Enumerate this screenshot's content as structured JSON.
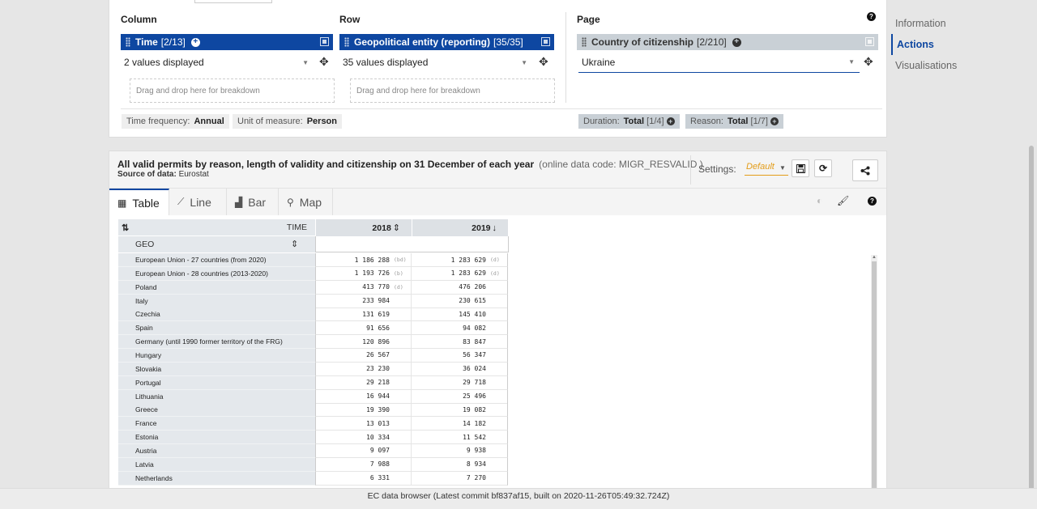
{
  "layout_panel": {
    "column": {
      "title": "Column",
      "dimension_name": "Time",
      "dimension_count": "[2/13]",
      "selection": "2 values displayed",
      "dropzone": "Drag and drop here for breakdown"
    },
    "row": {
      "title": "Row",
      "dimension_name": "Geopolitical entity (reporting)",
      "dimension_count": "[35/35]",
      "selection": "35 values displayed",
      "dropzone": "Drag and drop here for breakdown"
    },
    "page": {
      "title": "Page",
      "dimension_name": "Country of citizenship",
      "dimension_count": "[2/210]",
      "selection": "Ukraine"
    },
    "fixed_chips": [
      {
        "label": "Time frequency:",
        "value": "Annual"
      },
      {
        "label": "Unit of measure:",
        "value": "Person"
      }
    ],
    "page_chips": [
      {
        "label": "Duration:",
        "value": "Total",
        "count": "[1/4]"
      },
      {
        "label": "Reason:",
        "value": "Total",
        "count": "[1/7]"
      }
    ]
  },
  "side_nav": {
    "items": [
      "Information",
      "Actions",
      "Visualisations"
    ],
    "active": "Actions"
  },
  "dataset": {
    "title": "All valid permits by reason, length of validity and citizenship on 31 December of each year",
    "code": "(online data code: MIGR_RESVALID )",
    "source_label": "Source of data:",
    "source_value": "Eurostat",
    "settings_label": "Settings:",
    "settings_value": "Default"
  },
  "view_tabs": [
    {
      "label": "Table",
      "icon": "table-icon"
    },
    {
      "label": "Line",
      "icon": "line-chart-icon"
    },
    {
      "label": "Bar",
      "icon": "bar-chart-icon"
    },
    {
      "label": "Map",
      "icon": "map-marker-icon"
    }
  ],
  "active_tab": "Table",
  "table": {
    "time_label": "TIME",
    "geo_label": "GEO",
    "years": [
      "2018",
      "2019"
    ],
    "rows": [
      {
        "geo": "European Union - 27 countries (from 2020)",
        "v2018": "1 186 288",
        "f2018": "(bd)",
        "v2019": "1 283 629",
        "f2019": "(d)"
      },
      {
        "geo": "European Union - 28 countries (2013-2020)",
        "v2018": "1 193 726",
        "f2018": "(b)",
        "v2019": "1 283 629",
        "f2019": "(d)"
      },
      {
        "geo": "Poland",
        "v2018": "413 770",
        "f2018": "(d)",
        "v2019": "476 206",
        "f2019": ""
      },
      {
        "geo": "Italy",
        "v2018": "233 984",
        "f2018": "",
        "v2019": "230 615",
        "f2019": ""
      },
      {
        "geo": "Czechia",
        "v2018": "131 619",
        "f2018": "",
        "v2019": "145 410",
        "f2019": ""
      },
      {
        "geo": "Spain",
        "v2018": "91 656",
        "f2018": "",
        "v2019": "94 082",
        "f2019": ""
      },
      {
        "geo": "Germany (until 1990 former territory of the FRG)",
        "v2018": "120 896",
        "f2018": "",
        "v2019": "83 847",
        "f2019": ""
      },
      {
        "geo": "Hungary",
        "v2018": "26 567",
        "f2018": "",
        "v2019": "56 347",
        "f2019": ""
      },
      {
        "geo": "Slovakia",
        "v2018": "23 230",
        "f2018": "",
        "v2019": "36 024",
        "f2019": ""
      },
      {
        "geo": "Portugal",
        "v2018": "29 218",
        "f2018": "",
        "v2019": "29 718",
        "f2019": ""
      },
      {
        "geo": "Lithuania",
        "v2018": "16 944",
        "f2018": "",
        "v2019": "25 496",
        "f2019": ""
      },
      {
        "geo": "Greece",
        "v2018": "19 390",
        "f2018": "",
        "v2019": "19 082",
        "f2019": ""
      },
      {
        "geo": "France",
        "v2018": "13 013",
        "f2018": "",
        "v2019": "14 182",
        "f2019": ""
      },
      {
        "geo": "Estonia",
        "v2018": "10 334",
        "f2018": "",
        "v2019": "11 542",
        "f2019": ""
      },
      {
        "geo": "Austria",
        "v2018": "9 097",
        "f2018": "",
        "v2019": "9 938",
        "f2019": ""
      },
      {
        "geo": "Latvia",
        "v2018": "7 988",
        "f2018": "",
        "v2019": "8 934",
        "f2019": ""
      },
      {
        "geo": "Netherlands",
        "v2018": "6 331",
        "f2018": "",
        "v2019": "7 270",
        "f2019": ""
      }
    ]
  },
  "footer": "EC data browser (Latest commit bf837af15, built on 2020-11-26T05:49:32.724Z)",
  "colors": {
    "accent": "#0e47a1",
    "settings": "#e39c18"
  }
}
